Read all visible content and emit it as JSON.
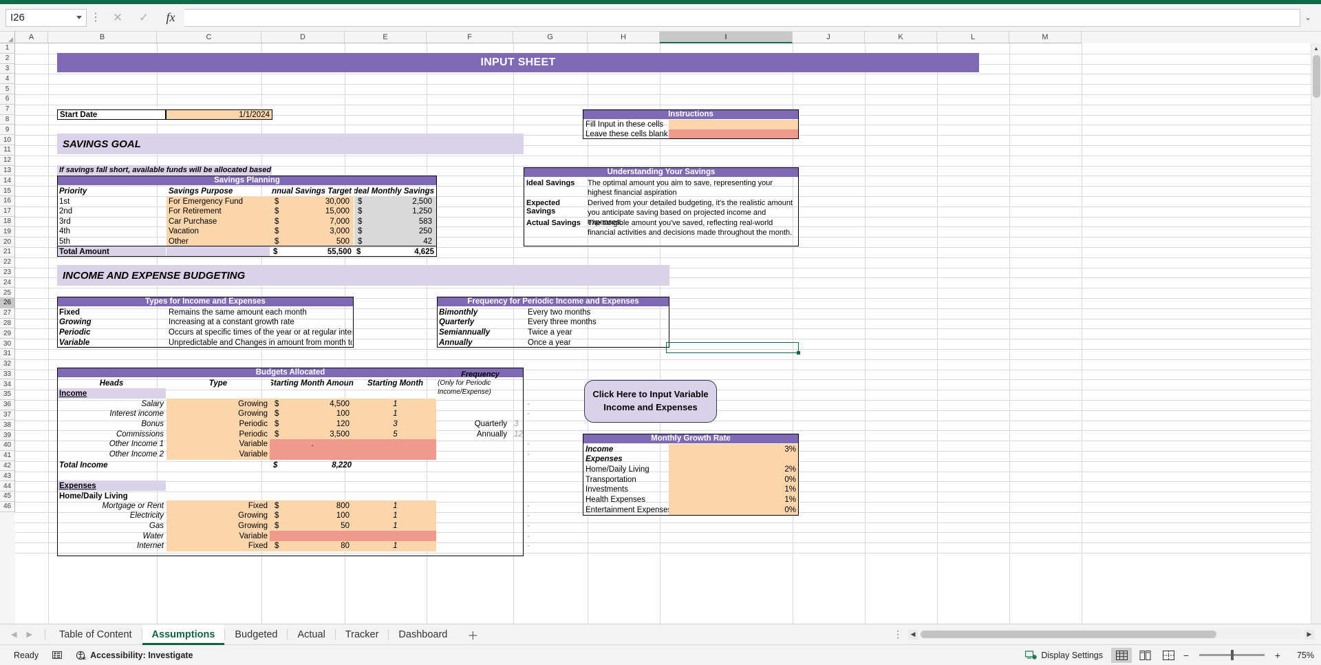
{
  "app": {
    "name_box_value": "I26",
    "formula_value": "",
    "cancel_icon": "close-icon",
    "confirm_icon": "check-icon",
    "fx_label": "fx"
  },
  "grid": {
    "columns": [
      "A",
      "B",
      "C",
      "D",
      "E",
      "F",
      "G",
      "H",
      "I",
      "J",
      "K",
      "L",
      "M"
    ],
    "selected_column": "I",
    "rows": [
      "1",
      "2",
      "3",
      "4",
      "5",
      "6",
      "7",
      "8",
      "9",
      "10",
      "11",
      "12",
      "13",
      "14",
      "15",
      "16",
      "17",
      "18",
      "19",
      "20",
      "21",
      "22",
      "23",
      "24",
      "25",
      "26",
      "27",
      "28",
      "29",
      "30",
      "31",
      "32",
      "33",
      "34",
      "35",
      "36",
      "37",
      "38",
      "39",
      "40",
      "41",
      "42",
      "43",
      "44",
      "45",
      "46"
    ],
    "selected_row": "26"
  },
  "sheet": {
    "title": "INPUT SHEET",
    "start_date_label": "Start Date",
    "start_date_value": "1/1/2024",
    "savings_goal_heading": "SAVINGS GOAL",
    "savings_note": "If savings fall short, available funds will be allocated based on priority.",
    "income_expense_heading": "INCOME AND EXPENSE BUDGETING"
  },
  "instructions": {
    "title": "Instructions",
    "rows": [
      {
        "label": "Fill Input in these cells",
        "swatch": "#fbd5ab"
      },
      {
        "label": "Leave these cells blank",
        "swatch": "#ef9a8d"
      }
    ]
  },
  "savings_planning": {
    "title": "Savings Planning",
    "headers": [
      "Priority",
      "Savings Purpose",
      "Annual Savings Target",
      "Ideal Monthly Savings"
    ],
    "rows": [
      {
        "priority": "1st",
        "purpose": "For Emergency Fund",
        "currency": "$",
        "annual": "30,000",
        "ideal_currency": "$",
        "ideal": "2,500"
      },
      {
        "priority": "2nd",
        "purpose": "For Retirement",
        "currency": "$",
        "annual": "15,000",
        "ideal_currency": "$",
        "ideal": "1,250"
      },
      {
        "priority": "3rd",
        "purpose": "Car Purchase",
        "currency": "$",
        "annual": "7,000",
        "ideal_currency": "$",
        "ideal": "583"
      },
      {
        "priority": "4th",
        "purpose": "Vacation",
        "currency": "$",
        "annual": "3,000",
        "ideal_currency": "$",
        "ideal": "250"
      },
      {
        "priority": "5th",
        "purpose": "Other",
        "currency": "$",
        "annual": "500",
        "ideal_currency": "$",
        "ideal": "42"
      }
    ],
    "total_label": "Total Amount",
    "total_currency": "$",
    "total_annual": "55,500",
    "total_ideal_currency": "$",
    "total_ideal": "4,625"
  },
  "understanding_savings": {
    "title": "Understanding Your Savings",
    "rows": [
      {
        "term": "Ideal Savings",
        "desc": "The optimal amount you aim to save, representing your highest financial aspiration"
      },
      {
        "term": "Expected Savings",
        "desc": "Derived from your detailed budgeting, it's the realistic amount you anticipate saving based on projected income and expenses."
      },
      {
        "term": "Actual Savings",
        "desc": "The tangible amount you've saved, reflecting real-world financial activities and decisions made throughout the month."
      }
    ]
  },
  "types_table": {
    "title": "Types for Income and Expenses",
    "rows": [
      {
        "term": "Fixed",
        "desc": "Remains the same amount each month"
      },
      {
        "term": "Growing",
        "desc": "Increasing at a constant growth rate"
      },
      {
        "term": "Periodic",
        "desc": "Occurs at specific times of the year or at regular intervals"
      },
      {
        "term": "Variable",
        "desc": "Unpredictable and Changes in amount from month to month"
      }
    ]
  },
  "frequency_table": {
    "title": "Frequency for Periodic Income and Expenses",
    "rows": [
      {
        "term": "Bimonthly",
        "desc": "Every two months"
      },
      {
        "term": "Quarterly",
        "desc": "Every three months"
      },
      {
        "term": "Semiannually",
        "desc": "Twice a year"
      },
      {
        "term": "Annually",
        "desc": "Once a year"
      }
    ]
  },
  "budgets_allocated": {
    "title": "Budgets Allocated",
    "headers": {
      "heads": "Heads",
      "type": "Type",
      "amount": "Starting Month Amount",
      "month": "Starting Month",
      "frequency": "Frequency",
      "frequency_note": "(Only for Periodic Income/Expense)"
    },
    "income_label": "Income",
    "income_rows": [
      {
        "head": "Salary",
        "type": "Growing",
        "cur": "$",
        "amount": "4,500",
        "month": "1",
        "freq": "",
        "freqnum": "",
        "blank": false
      },
      {
        "head": "Interest income",
        "type": "Growing",
        "cur": "$",
        "amount": "100",
        "month": "1",
        "freq": "",
        "freqnum": "",
        "blank": false
      },
      {
        "head": "Bonus",
        "type": "Periodic",
        "cur": "$",
        "amount": "120",
        "month": "3",
        "freq": "Quarterly",
        "freqnum": "3",
        "blank": false
      },
      {
        "head": "Commissions",
        "type": "Periodic",
        "cur": "$",
        "amount": "3,500",
        "month": "5",
        "freq": "Annually",
        "freqnum": "12",
        "blank": false
      },
      {
        "head": "Other Income 1",
        "type": "Variable",
        "cur": "",
        "amount": ".",
        "month": "",
        "freq": "",
        "freqnum": "",
        "blank": true
      },
      {
        "head": "Other Income 2",
        "type": "Variable",
        "cur": "",
        "amount": "",
        "month": "",
        "freq": "",
        "freqnum": "",
        "blank": true
      }
    ],
    "total_income_label": "Total Income",
    "total_income_cur": "$",
    "total_income_value": "8,220",
    "expenses_label": "Expenses",
    "expense_group_label": "Home/Daily Living",
    "expense_rows": [
      {
        "head": "Mortgage or Rent",
        "type": "Fixed",
        "cur": "$",
        "amount": "800",
        "month": "1",
        "blank": false
      },
      {
        "head": "Electricity",
        "type": "Growing",
        "cur": "$",
        "amount": "100",
        "month": "1",
        "blank": false
      },
      {
        "head": "Gas",
        "type": "Growing",
        "cur": "$",
        "amount": "50",
        "month": "1",
        "blank": false
      },
      {
        "head": "Water",
        "type": "Variable",
        "cur": "",
        "amount": "",
        "month": "",
        "blank": true
      },
      {
        "head": "Internet",
        "type": "Fixed",
        "cur": "$",
        "amount": "80",
        "month": "1",
        "blank": false
      }
    ]
  },
  "variable_button": {
    "line1": "Click Here to Input Variable",
    "line2": "Income and Expenses"
  },
  "growth_rate": {
    "title": "Monthly Growth Rate",
    "rows": [
      {
        "label": "Income",
        "value": "3%",
        "italic": true
      },
      {
        "label": "Expenses",
        "value": "",
        "italic": true
      },
      {
        "label": "Home/Daily Living",
        "value": "2%",
        "italic": false
      },
      {
        "label": "Transportation",
        "value": "0%",
        "italic": false
      },
      {
        "label": "Investments",
        "value": "1%",
        "italic": false
      },
      {
        "label": "Health Expenses",
        "value": "1%",
        "italic": false
      },
      {
        "label": "Entertainment Expenses",
        "value": "0%",
        "italic": false
      }
    ]
  },
  "tabs": {
    "items": [
      {
        "label": "Table of Content",
        "active": false
      },
      {
        "label": "Assumptions",
        "active": true
      },
      {
        "label": "Budgeted",
        "active": false
      },
      {
        "label": "Actual",
        "active": false
      },
      {
        "label": "Tracker",
        "active": false
      },
      {
        "label": "Dashboard",
        "active": false
      }
    ],
    "add_sheet_icon": "plus-icon",
    "prev_icon": "chevron-left-icon",
    "next_icon": "chevron-right-icon"
  },
  "status": {
    "ready": "Ready",
    "accessibility": "Accessibility: Investigate",
    "display_settings": "Display Settings",
    "zoom": "75%",
    "zoom_out": "−",
    "zoom_in": "+",
    "normal_view_icon": "normal-view-icon",
    "layout_view_icon": "page-layout-icon",
    "pagebreak_view_icon": "page-break-icon"
  },
  "colors": {
    "purple": "#8069b4",
    "lilac": "#d9d2e9",
    "peach": "#fbd5ab",
    "salmon": "#ef9a8d",
    "gray": "#d9d9d9",
    "excel_green": "#0d6b45"
  }
}
